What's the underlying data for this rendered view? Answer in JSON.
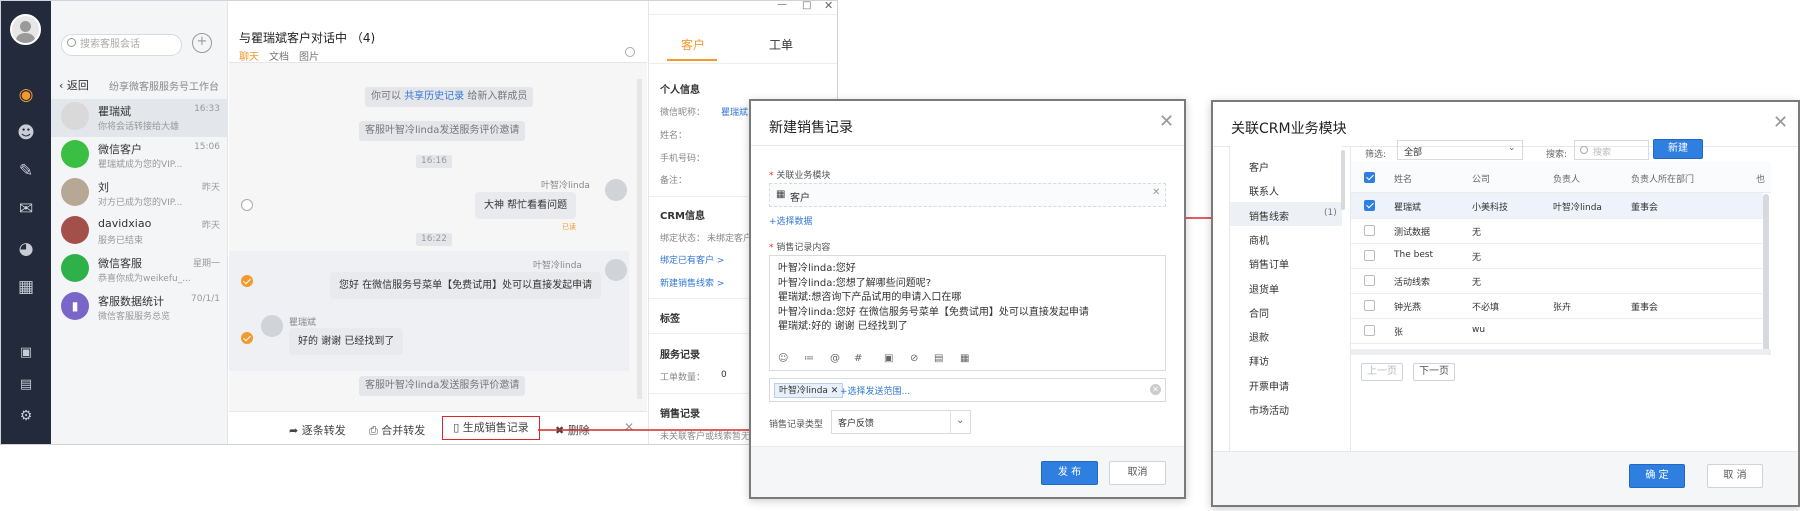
{
  "sessions": {
    "search_placeholder": "搜索客服会话",
    "back_label": "返回",
    "workspace_title": "纷享微客服服务号工作台",
    "items": [
      {
        "name": "瞿瑞斌",
        "preview": "你将会话转接给大雄",
        "time": "16:33"
      },
      {
        "name": "微信客户",
        "preview": "瞿瑞斌成为您的VIP...",
        "time": "15:06"
      },
      {
        "name": "刘",
        "preview": "对方已成为您的VIP...",
        "time": "昨天"
      },
      {
        "name": "davidxiao",
        "preview": "服务已结束",
        "time": "昨天"
      },
      {
        "name": "微信客服",
        "preview": "恭喜你成为weikefu_...",
        "time": "星期一"
      },
      {
        "name": "客服数据统计",
        "preview": "微信客服服务总览",
        "time": "70/1/1"
      }
    ]
  },
  "chat": {
    "title": "与瞿瑞斌客户对话中 （4)",
    "tabs": [
      "聊天",
      "文档",
      "图片"
    ],
    "sys_history_prefix": "你可以",
    "sys_history_link": "共享历史记录",
    "sys_history_suffix": "给新入群成员",
    "sys_eval_1": "客服叶智冷linda发送服务评价邀请",
    "sys_eval_2": "客服叶智冷linda发送服务评价邀请",
    "time_1": "16:16",
    "time_2": "16:22",
    "msg1_sender": "叶智冷linda",
    "msg1_text": "大神 帮忙看看问题",
    "msg1_status": "已读",
    "msg2_sender": "叶智冷linda",
    "msg2_text": "您好 在微信服务号菜单【免费试用】处可以直接发起申请",
    "msg3_sender": "瞿瑞斌",
    "msg3_text": "好的 谢谢 已经找到了",
    "bar_forward_each": "逐条转发",
    "bar_forward_merge": "合并转发",
    "bar_gen_sales": "生成销售记录",
    "bar_delete": "删除"
  },
  "crm": {
    "tab_customer": "客户",
    "tab_workorder": "工单",
    "section_personal": "个人信息",
    "wechat_nick_label": "微信昵称：",
    "wechat_nick_value": "瞿瑞斌",
    "name_label": "姓名：",
    "phone_label": "手机号码：",
    "remark_label": "备注：",
    "section_crm": "CRM信息",
    "bind_status_label": "绑定状态：",
    "bind_status_value": "未绑定客户",
    "bind_existing": "绑定已有客户 >",
    "new_lead": "新建销售线索 >",
    "section_tag": "标签",
    "section_service": "服务记录",
    "ticket_count_label": "工单数量：",
    "ticket_count_value": "0",
    "section_sales": "销售记录",
    "sales_hint": "未关联客户或线索暂无"
  },
  "dialog_sales": {
    "title": "新建销售记录",
    "module_label": "关联业务模块",
    "module_value": "客户",
    "select_data_link": "+选择数据",
    "content_label": "销售记录内容",
    "content_lines": [
      "叶智冷linda:您好",
      "叶智冷linda:您想了解哪些问题呢?",
      "瞿瑞斌:想咨询下产品试用的申请入口在哪",
      "叶智冷linda:您好 在微信服务号菜单【免费试用】处可以直接发起申请",
      "瞿瑞斌:好的 谢谢 已经找到了"
    ],
    "toolbar_icons": [
      "☺",
      "≔",
      "@",
      "#",
      "▣",
      "⊘",
      "▤",
      "▦"
    ],
    "scope_tag": "叶智冷linda",
    "scope_add": "+选择发送范围...",
    "type_label": "销售记录类型",
    "type_value": "客户反馈",
    "publish": "发 布",
    "cancel": "取消"
  },
  "dialog_crm": {
    "title": "关联CRM业务模块",
    "modules": [
      "客户",
      "联系人",
      "销售线索",
      "商机",
      "销售订单",
      "退货单",
      "合同",
      "退款",
      "拜访",
      "开票申请",
      "市场活动"
    ],
    "selected_module_count": "(1)",
    "filter_label": "筛选:",
    "filter_value": "全部",
    "search_label": "搜索:",
    "search_placeholder": "搜索",
    "new_button": "新建",
    "columns": [
      "姓名",
      "公司",
      "负责人",
      "负责人所在部门",
      "也"
    ],
    "rows": [
      {
        "checked": true,
        "name": "瞿瑞斌",
        "company": "小美科技",
        "owner": "叶智冷linda",
        "dept": "董事会"
      },
      {
        "checked": false,
        "name": "测试数据",
        "company": "无",
        "owner": "",
        "dept": ""
      },
      {
        "checked": false,
        "name": "The best",
        "company": "无",
        "owner": "",
        "dept": ""
      },
      {
        "checked": false,
        "name": "活动线索",
        "company": "无",
        "owner": "",
        "dept": ""
      },
      {
        "checked": false,
        "name": "钟光燕",
        "company": "不必填",
        "owner": "张卉",
        "dept": "董事会"
      },
      {
        "checked": false,
        "name": "张",
        "company": "wu",
        "owner": "",
        "dept": ""
      }
    ],
    "prev_page": "上一页",
    "next_page": "下一页",
    "confirm": "确 定",
    "cancel": "取 消"
  },
  "colors": {
    "accent_orange": "#f29a2e",
    "primary_blue": "#2f7fe0",
    "connector_red": "#d9262c",
    "rail_dark": "#222a3b"
  }
}
